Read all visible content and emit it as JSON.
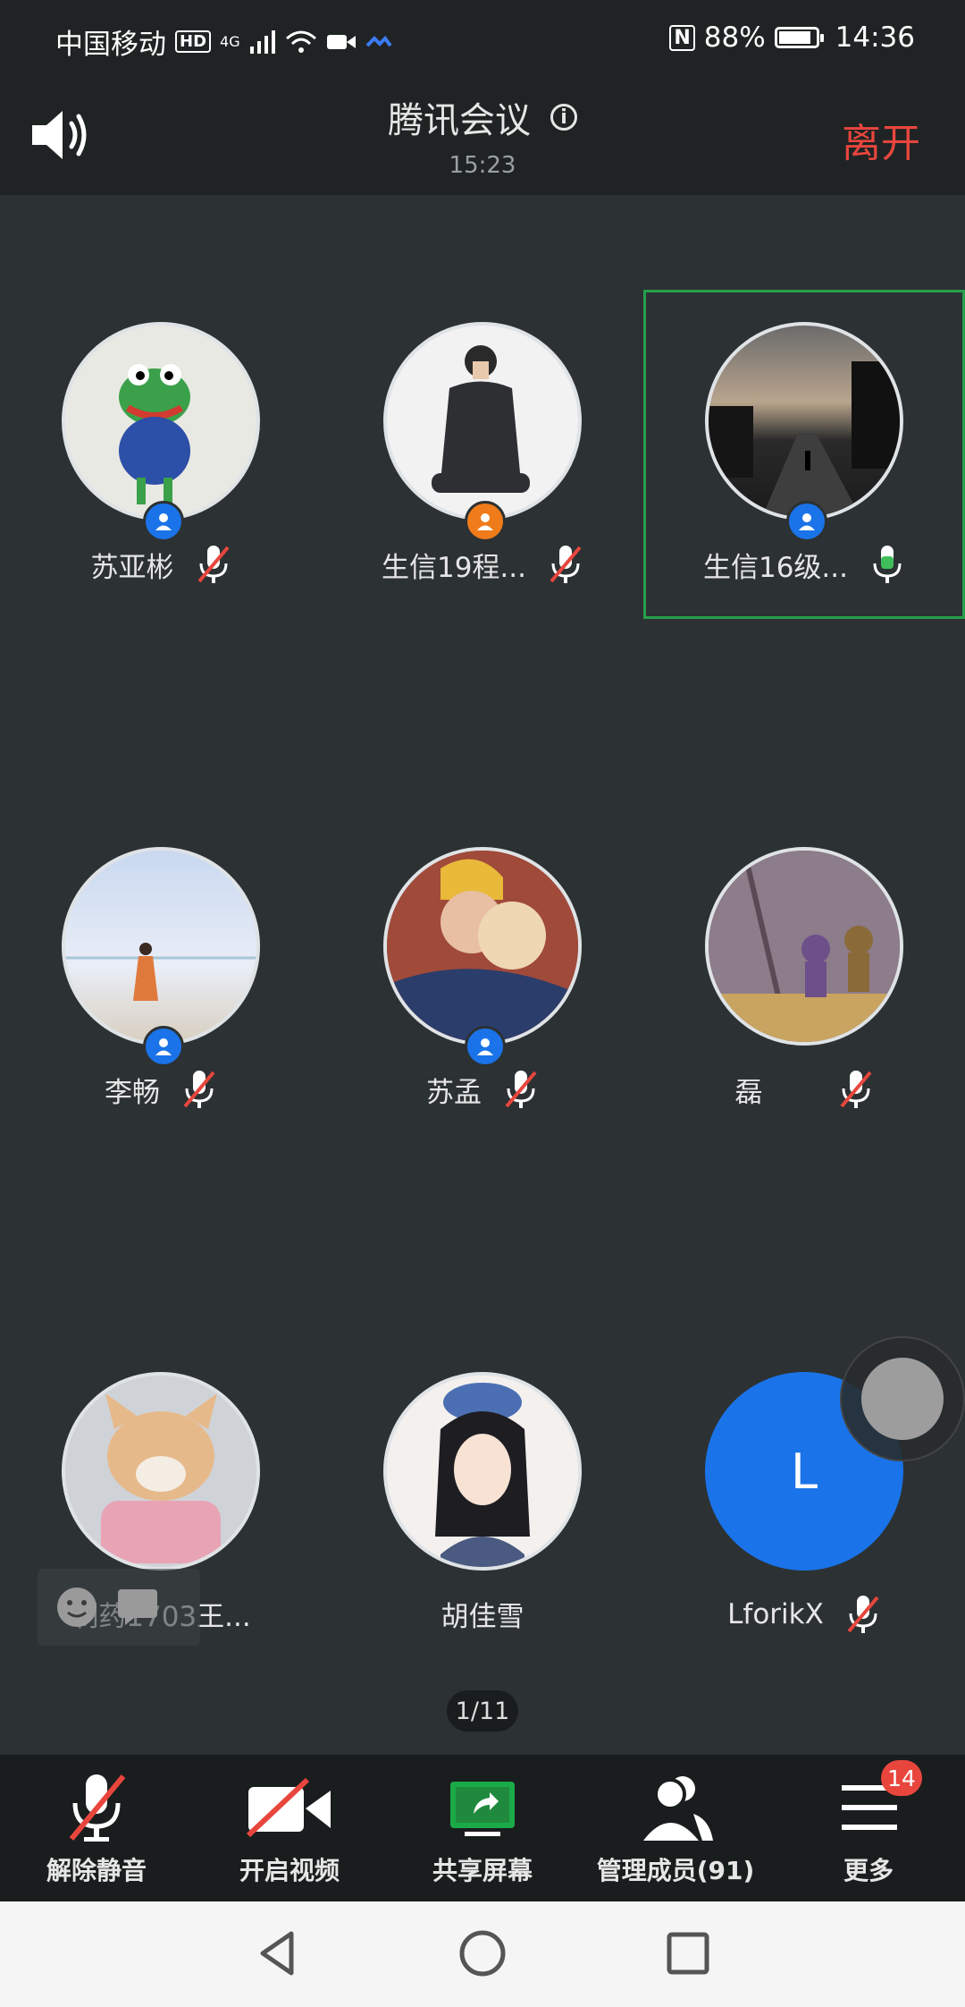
{
  "status_bar": {
    "carrier": "中国移动",
    "hd": "HD",
    "network": "4G",
    "nfc": "N",
    "battery": "88%",
    "battery_level": 0.88,
    "time": "14:36"
  },
  "header": {
    "title": "腾讯会议",
    "elapsed": "15:23",
    "leave_label": "离开"
  },
  "participants": [
    {
      "name": "苏亚彬",
      "muted": true,
      "badge": "blue",
      "avatar": "frog-plush-photo"
    },
    {
      "name": "生信19程...",
      "muted": true,
      "badge": "orange",
      "avatar": "man-in-coat-photo"
    },
    {
      "name": "生信16级...",
      "muted": false,
      "badge": "blue",
      "avatar": "sunset-road-photo",
      "speaking": true
    },
    {
      "name": "李畅",
      "muted": true,
      "badge": "blue",
      "avatar": "beach-girl-photo"
    },
    {
      "name": "苏孟",
      "muted": true,
      "badge": "blue",
      "avatar": "couple-photo"
    },
    {
      "name": "磊",
      "muted": true,
      "badge": null,
      "avatar": "cartoon-photo"
    },
    {
      "name": "制药1703王...",
      "muted": false,
      "badge": null,
      "avatar": "cat-photo"
    },
    {
      "name": "胡佳雪",
      "muted": false,
      "badge": null,
      "avatar": "anime-girl-photo"
    },
    {
      "name": "LforikX",
      "muted": true,
      "badge": null,
      "avatar_letter": "L",
      "avatar_color": "#1a73e8"
    }
  ],
  "pager": "1/11",
  "toolbar": {
    "unmute": "解除静音",
    "video": "开启视频",
    "share": "共享屏幕",
    "members": "管理成员(91)",
    "more": "更多",
    "more_badge": "14"
  },
  "colors": {
    "accent_red": "#e8463d",
    "speaking_green": "#27a04a",
    "share_green": "#1aab48",
    "blue": "#1a73e8"
  }
}
